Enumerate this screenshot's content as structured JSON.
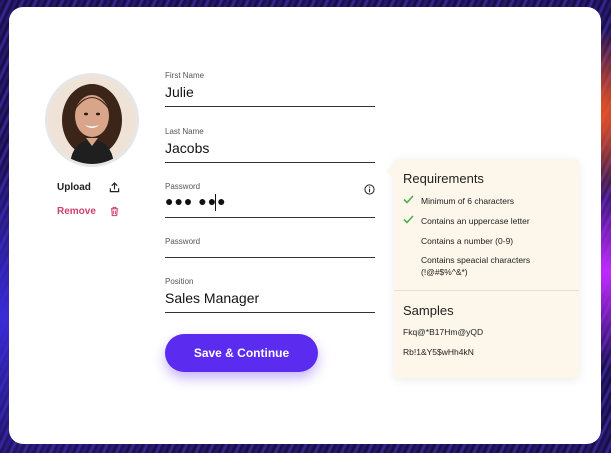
{
  "profile": {
    "upload_label": "Upload",
    "remove_label": "Remove",
    "remove_color": "#d0406f"
  },
  "form": {
    "first_name": {
      "label": "First Name",
      "value": "Julie"
    },
    "last_name": {
      "label": "Last Name",
      "value": "Jacobs"
    },
    "password": {
      "label": "Password",
      "value_masked": "●●● ●●●"
    },
    "confirm_password": {
      "label": "Password",
      "value": ""
    },
    "position": {
      "label": "Position",
      "value": "Sales Manager"
    },
    "submit_label": "Save & Continue",
    "accent_color": "#5b2cf0"
  },
  "requirements": {
    "title": "Requirements",
    "items": [
      {
        "text": "Minimum of 6 characters",
        "met": true
      },
      {
        "text": "Contains an uppercase letter",
        "met": true
      },
      {
        "text": "Contains a number (0-9)",
        "met": false
      },
      {
        "text": "Contains speacial characters (!@#$%^&*)",
        "met": false
      }
    ],
    "check_color": "#4caf50"
  },
  "samples": {
    "title": "Samples",
    "items": [
      "Fkq@*B17Hm@yQD",
      "Rb!1&Y5$wHh4kN"
    ]
  },
  "icons": {
    "upload": "upload-icon",
    "remove": "trash-icon",
    "info": "info-icon",
    "check": "check-icon"
  }
}
